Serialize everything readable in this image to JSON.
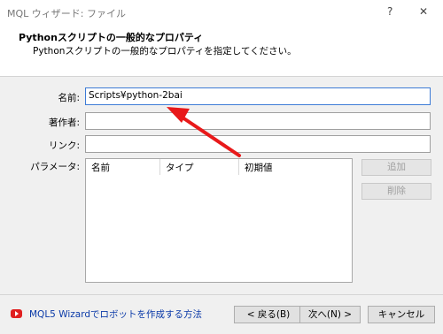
{
  "window": {
    "title": "MQL ウィザード: ファイル",
    "help_glyph": "?",
    "close_glyph": "✕"
  },
  "header": {
    "title": "Pythonスクリプトの一般的なプロパティ",
    "subtitle": "Pythonスクリプトの一般的なプロパティを指定してください。"
  },
  "form": {
    "name_label": "名前:",
    "name_value": "Scripts¥python-2bai",
    "author_label": "著作者:",
    "author_value": "",
    "link_label": "リンク:",
    "link_value": "",
    "params_label": "パラメータ:"
  },
  "params_table": {
    "columns": [
      "名前",
      "タイプ",
      "初期値"
    ],
    "rows": []
  },
  "side_buttons": {
    "add": "追加",
    "delete": "削除"
  },
  "footer": {
    "help_link": "MQL5 Wizardでロボットを作成する方法",
    "back": "< 戻る(B)",
    "next": "次へ(N) >",
    "cancel": "キャンセル"
  },
  "colors": {
    "arrow": "#e8191a",
    "link": "#0b3aa8",
    "focus_border": "#3d7bd6",
    "video_icon": "#e02020"
  }
}
